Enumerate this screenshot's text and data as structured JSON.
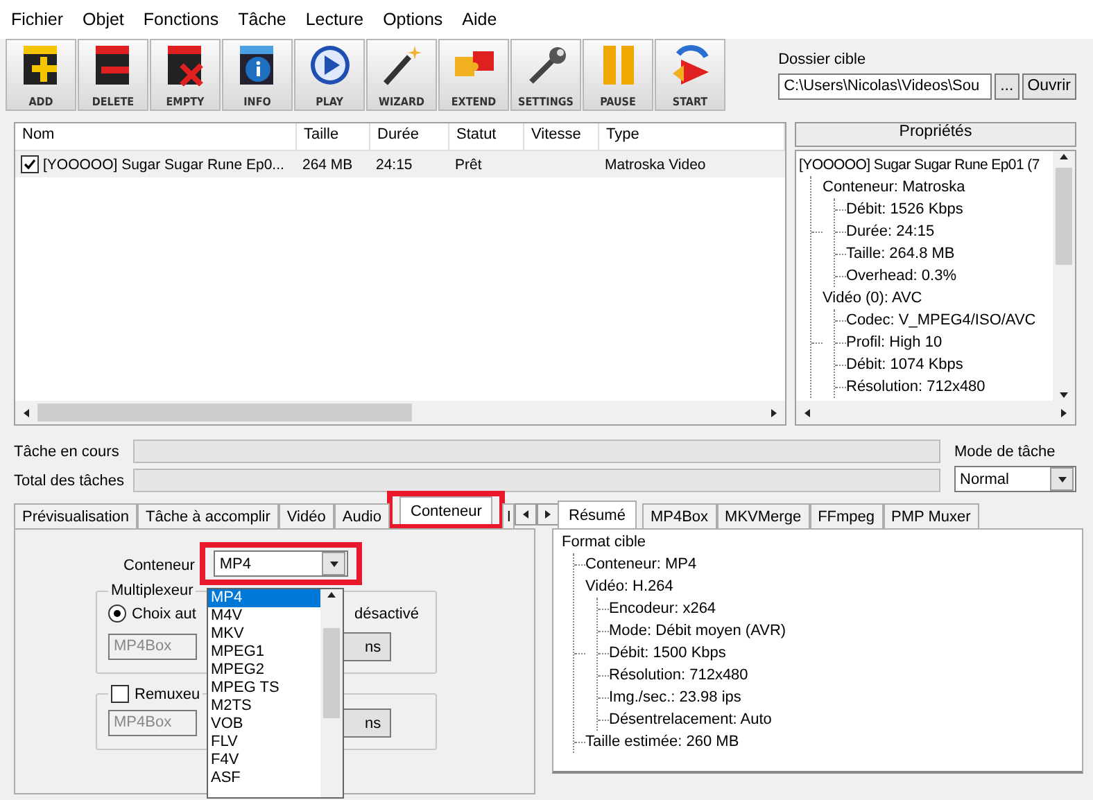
{
  "menu": [
    "Fichier",
    "Objet",
    "Fonctions",
    "Tâche",
    "Lecture",
    "Options",
    "Aide"
  ],
  "toolbar": [
    {
      "label": "ADD",
      "kind": "add"
    },
    {
      "label": "DELETE",
      "kind": "delete"
    },
    {
      "label": "EMPTY",
      "kind": "empty"
    },
    {
      "label": "INFO",
      "kind": "info"
    },
    {
      "label": "PLAY",
      "kind": "play"
    },
    {
      "label": "WIZARD",
      "kind": "wizard"
    },
    {
      "label": "EXTEND",
      "kind": "extend"
    },
    {
      "label": "SETTINGS",
      "kind": "settings"
    },
    {
      "label": "PAUSE",
      "kind": "pause"
    },
    {
      "label": "START",
      "kind": "start"
    }
  ],
  "target_folder": {
    "label": "Dossier cible",
    "value": "C:\\Users\\Nicolas\\Videos\\Sou",
    "browse_button": "...",
    "open_button": "Ouvrir"
  },
  "file_list": {
    "columns": [
      "Nom",
      "Taille",
      "Durée",
      "Statut",
      "Vitesse",
      "Type"
    ],
    "rows": [
      {
        "checked": true,
        "cells": [
          "[YOOOOO] Sugar Sugar Rune Ep0...",
          "264 MB",
          "24:15",
          "Prêt",
          "",
          "Matroska Video"
        ]
      }
    ]
  },
  "properties": {
    "title": "Propriétés",
    "tree": [
      {
        "label": "[YOOOOO] Sugar Sugar Rune Ep01 (7",
        "children": [
          {
            "label": "Conteneur: Matroska",
            "children": [
              {
                "label": "Débit: 1526 Kbps"
              },
              {
                "label": "Durée: 24:15"
              },
              {
                "label": "Taille: 264.8 MB"
              },
              {
                "label": "Overhead: 0.3%"
              }
            ]
          },
          {
            "label": "Vidéo (0): AVC",
            "children": [
              {
                "label": "Codec: V_MPEG4/ISO/AVC"
              },
              {
                "label": "Profil: High 10"
              },
              {
                "label": "Débit: 1074 Kbps"
              },
              {
                "label": "Résolution: 712x480"
              }
            ]
          }
        ]
      }
    ]
  },
  "progress": [
    {
      "label": "Tâche en cours",
      "level": 0
    },
    {
      "label": "Total des tâches",
      "level": 0
    }
  ],
  "task_mode": {
    "label": "Mode de tâche",
    "value": "Normal"
  },
  "left_tabs": [
    {
      "label": "Prévisualisation",
      "selected": false
    },
    {
      "label": "Tâche à accomplir",
      "selected": false
    },
    {
      "label": "Vidéo",
      "selected": false
    },
    {
      "label": "Audio",
      "selected": false
    },
    {
      "label": "Conteneur",
      "selected": true
    },
    {
      "label": "I",
      "selected": false
    }
  ],
  "container": {
    "label": "Conteneur",
    "value": "MP4",
    "options": [
      {
        "label": "MP4",
        "selected": true
      },
      {
        "label": "M4V",
        "selected": false
      },
      {
        "label": "MKV",
        "selected": false
      },
      {
        "label": "MPEG1",
        "selected": false
      },
      {
        "label": "MPEG2",
        "selected": false
      },
      {
        "label": "MPEG TS",
        "selected": false
      },
      {
        "label": "M2TS",
        "selected": false
      },
      {
        "label": "VOB",
        "selected": false
      },
      {
        "label": "FLV",
        "selected": false
      },
      {
        "label": "F4V",
        "selected": false
      },
      {
        "label": "ASF",
        "selected": false
      }
    ]
  },
  "multiplexer": {
    "title": "Multiplexeur",
    "radio_label": "Choix aut",
    "radio_selected": true,
    "radio2_label": "désactivé",
    "field": "MP4Box",
    "button": "ns"
  },
  "remuxer": {
    "title": "Remuxeu",
    "checked": false,
    "field": "MP4Box",
    "button": "ns"
  },
  "right_tabs": [
    {
      "label": "Résumé",
      "selected": true
    },
    {
      "label": "MP4Box",
      "selected": false
    },
    {
      "label": "MKVMerge",
      "selected": false
    },
    {
      "label": "FFmpeg",
      "selected": false
    },
    {
      "label": "PMP Muxer",
      "selected": false
    }
  ],
  "summary": [
    {
      "label": "Format cible",
      "children": [
        {
          "label": "Conteneur: MP4"
        },
        {
          "label": "Vidéo: H.264",
          "children": [
            {
              "label": "Encodeur: x264"
            },
            {
              "label": "Mode: Débit moyen (AVR)"
            },
            {
              "label": "Débit: 1500 Kbps"
            },
            {
              "label": "Résolution: 712x480"
            },
            {
              "label": "Img./sec.: 23.98 ips"
            },
            {
              "label": "Désentrelacement: Auto"
            }
          ]
        },
        {
          "label": "Taille estimée: 260 MB"
        }
      ]
    }
  ]
}
